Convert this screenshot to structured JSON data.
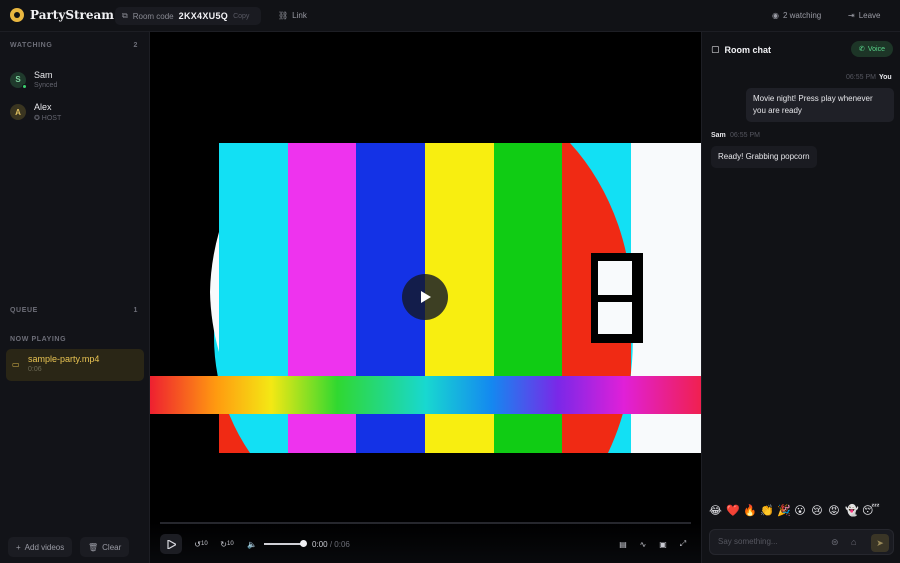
{
  "app": {
    "name": "PartyStream"
  },
  "header": {
    "room_code_label": "Room code",
    "room_code": "2KX4XU5Q",
    "copy_label": "Copy",
    "link_label": "Link",
    "watching_label": "2 watching",
    "leave_label": "Leave"
  },
  "sidebar": {
    "watching_title": "WATCHING",
    "watching_count": "2",
    "viewers": [
      {
        "initial": "S",
        "name": "Sam",
        "status": "Synced",
        "avatar_bg": "#1f3a2c",
        "avatar_fg": "#7fd4a0"
      },
      {
        "initial": "A",
        "name": "Alex",
        "status": "✪ HOST",
        "avatar_bg": "#3a3520",
        "avatar_fg": "#e0c060"
      }
    ],
    "queue_title": "QUEUE",
    "queue_count": "1",
    "now_playing_title": "NOW PLAYING",
    "now_playing": {
      "title": "sample-party.mp4",
      "subtitle": "0:06"
    },
    "add_videos_label": "Add videos",
    "clear_label": "Clear"
  },
  "player": {
    "time_current": "0:00",
    "time_total": "0:06",
    "volume": 1.0,
    "progress": 0.0,
    "skip_back_label": "10",
    "skip_forward_label": "10"
  },
  "chat": {
    "title": "Room chat",
    "voice_label": "Voice",
    "messages": [
      {
        "author": "You",
        "time": "06:55 PM",
        "text": "Movie night! Press play whenever you are ready",
        "own": true
      },
      {
        "author": "Sam",
        "time": "06:55 PM",
        "text": "Ready! Grabbing popcorn",
        "own": false
      }
    ],
    "emojis": [
      "😂",
      "❤️",
      "🔥",
      "👏",
      "🎉",
      "😮",
      "😢",
      "😡",
      "👻",
      "😴"
    ],
    "input_placeholder": "Say something..."
  }
}
